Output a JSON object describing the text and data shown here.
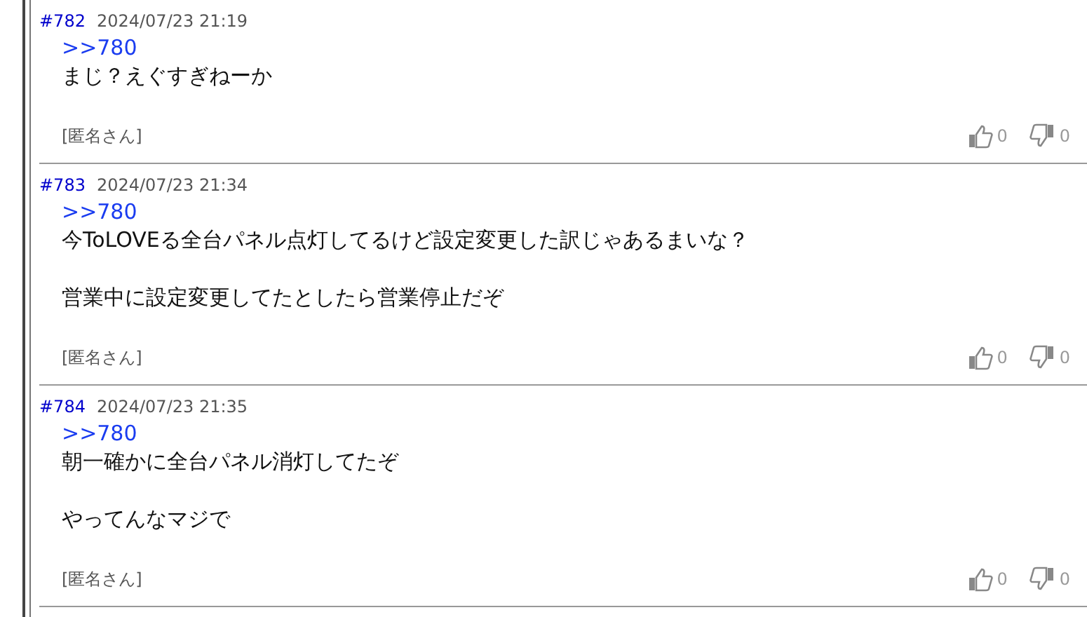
{
  "posts": [
    {
      "number": "#782",
      "date": "2024/07/23 21:19",
      "reply_to": ">>780",
      "paragraphs": [
        "まじ？えぐすぎねーか"
      ],
      "author": "[匿名さん]",
      "likes": "0",
      "dislikes": "0"
    },
    {
      "number": "#783",
      "date": "2024/07/23 21:34",
      "reply_to": ">>780",
      "paragraphs": [
        "今ToLOVEる全台パネル点灯してるけど設定変更した訳じゃあるまいな？",
        "営業中に設定変更してたとしたら営業停止だぞ"
      ],
      "author": "[匿名さん]",
      "likes": "0",
      "dislikes": "0"
    },
    {
      "number": "#784",
      "date": "2024/07/23 21:35",
      "reply_to": ">>780",
      "paragraphs": [
        "朝一確かに全台パネル消灯してたぞ",
        "やってんなマジで"
      ],
      "author": "[匿名さん]",
      "likes": "0",
      "dislikes": "0"
    }
  ]
}
